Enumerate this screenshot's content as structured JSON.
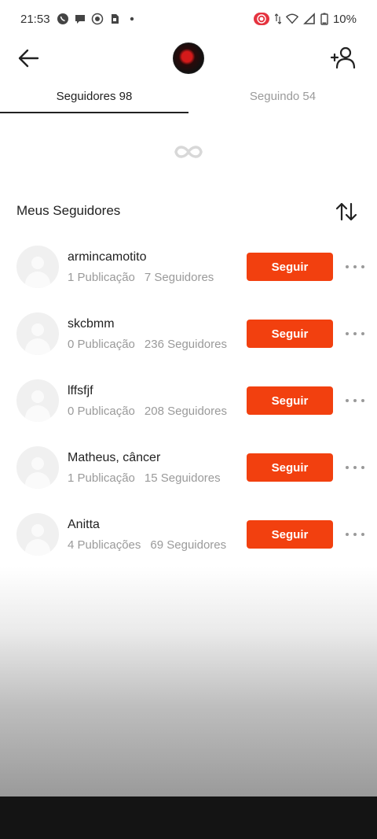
{
  "status_bar": {
    "time": "21:53",
    "battery": "10%",
    "icons": [
      "whatsapp-icon",
      "chat-icon",
      "record-icon",
      "sim-icon",
      "dot-icon",
      "screen-record-icon",
      "data-arrows-icon",
      "wifi-icon",
      "signal-icon",
      "battery-icon"
    ]
  },
  "header": {
    "back_icon": "arrow-left-icon",
    "add_user_icon": "add-user-icon"
  },
  "tabs": [
    {
      "label": "Seguidores 98",
      "active": true
    },
    {
      "label": "Seguindo 54",
      "active": false
    }
  ],
  "section": {
    "title": "Meus Seguidores",
    "sort_icon": "sort-arrows-icon"
  },
  "followers": [
    {
      "name": "armincamotito",
      "posts": "1 Publicação",
      "followers": "7 Seguidores",
      "button": "Seguir"
    },
    {
      "name": "skcbmm",
      "posts": "0 Publicação",
      "followers": "236 Seguidores",
      "button": "Seguir"
    },
    {
      "name": "lffsfjf",
      "posts": "0 Publicação",
      "followers": "208 Seguidores",
      "button": "Seguir"
    },
    {
      "name": "Matheus, câncer",
      "posts": "1 Publicação",
      "followers": "15 Seguidores",
      "button": "Seguir"
    },
    {
      "name": "Anitta",
      "posts": "4 Publicações",
      "followers": "69 Seguidores",
      "button": "Seguir"
    }
  ],
  "colors": {
    "accent": "#f2400f",
    "text": "#222222",
    "muted": "#9a9a9a"
  }
}
